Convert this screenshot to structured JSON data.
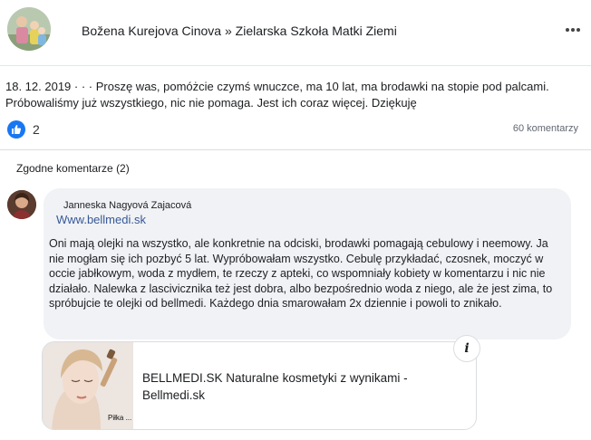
{
  "post": {
    "header_title": "Božena Kurejova Cinova » Zielarska Szkoła Matki Ziemi",
    "date": "18. 12. 2019",
    "separator": " · · · ",
    "text": "Proszę was, pomóżcie czymś wnuczce, ma 10 lat, ma brodawki na stopie pod palcami. Próbowaliśmy już wszystkiego, nic nie pomaga. Jest ich coraz więcej. Dziękuję",
    "reaction_count": "2",
    "comment_count": "60 komentarzy"
  },
  "comments": {
    "sort_label": "Zgodne komentarze (2)",
    "first": {
      "author": "Janneska Nagyová Zajacová",
      "link": "Www.bellmedi.sk",
      "text": "Oni mają olejki na wszystko, ale konkretnie na odciski, brodawki pomagają cebulowy i neemowy. Ja nie mogłam się ich pozbyć 5 lat. Wypróbowałam wszystko. Cebulę przykładać, czosnek, moczyć w occie jabłkowym, woda z mydłem, te rzeczy z apteki, co wspomniały kobiety w komentarzu i nic nie działało. Nalewka z lascivicznika też jest dobra, albo bezpośrednio woda z niego, ale że jest zima, to spróbujcie te olejki od bellmedi. Każdego dnia smarowałam 2x dziennie i powoli to znikało."
    },
    "link_card": {
      "title": "BELLMEDI.SK Naturalne kosmetyki z wynikami - Bellmedi.sk",
      "image_caption": "Piłka ...",
      "info_glyph": "i"
    }
  },
  "colors": {
    "accent": "#1877f2",
    "link": "#385898",
    "bubble": "#f0f2f5"
  },
  "icons": [
    "like-icon",
    "more-icon",
    "info-icon"
  ]
}
